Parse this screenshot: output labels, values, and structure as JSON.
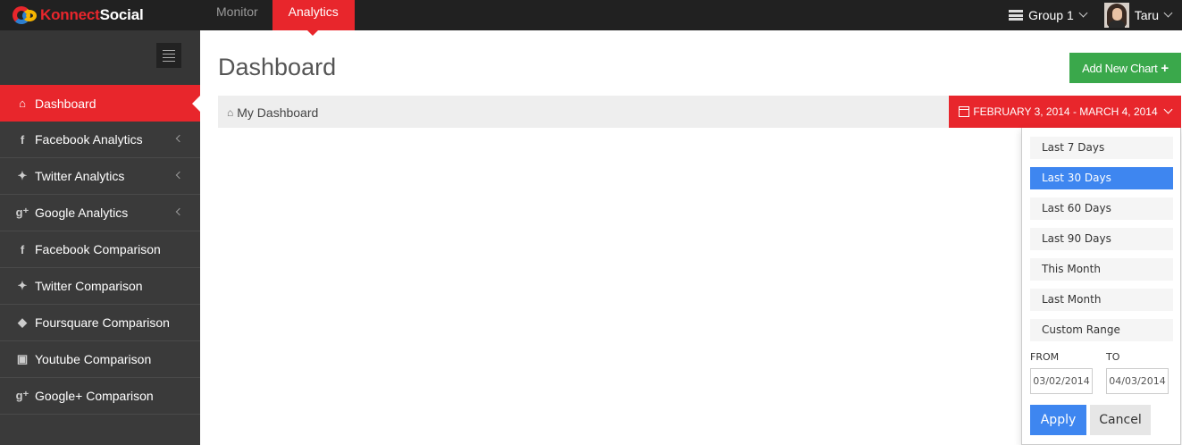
{
  "brand": {
    "name_part1": "Konnect",
    "name_part2": "Social"
  },
  "topnav": {
    "items": [
      {
        "label": "Monitor"
      },
      {
        "label": "Analytics"
      }
    ]
  },
  "topright": {
    "group_label": "Group 1",
    "user_name": "Taru"
  },
  "sidebar": {
    "items": [
      {
        "label": "Dashboard",
        "icon": "home-icon"
      },
      {
        "label": "Facebook Analytics",
        "icon": "facebook-icon"
      },
      {
        "label": "Twitter Analytics",
        "icon": "twitter-icon"
      },
      {
        "label": "Google Analytics",
        "icon": "google-plus-icon"
      },
      {
        "label": "Facebook Comparison",
        "icon": "facebook-icon"
      },
      {
        "label": "Twitter Comparison",
        "icon": "twitter-icon"
      },
      {
        "label": "Foursquare Comparison",
        "icon": "foursquare-icon"
      },
      {
        "label": "Youtube Comparison",
        "icon": "youtube-icon"
      },
      {
        "label": "Google+ Comparison",
        "icon": "google-plus-icon"
      }
    ]
  },
  "main": {
    "title": "Dashboard",
    "add_chart_label": "Add New Chart",
    "breadcrumb": "My Dashboard",
    "date_range_label": "FEBRUARY 3, 2014 - MARCH 4, 2014"
  },
  "daterange": {
    "ranges": [
      "Last 7 Days",
      "Last 30 Days",
      "Last 60 Days",
      "Last 90 Days",
      "This Month",
      "Last Month",
      "Custom Range"
    ],
    "selected": "Last 30 Days",
    "from_label": "FROM",
    "to_label": "TO",
    "from_value": "03/02/2014",
    "to_value": "04/03/2014",
    "apply_label": "Apply",
    "cancel_label": "Cancel"
  },
  "colors": {
    "accent": "#e8262c",
    "success": "#3aa84b",
    "primary": "#3e86f0",
    "sidebar_bg": "#3a3a3a",
    "topbar_bg": "#212121"
  }
}
